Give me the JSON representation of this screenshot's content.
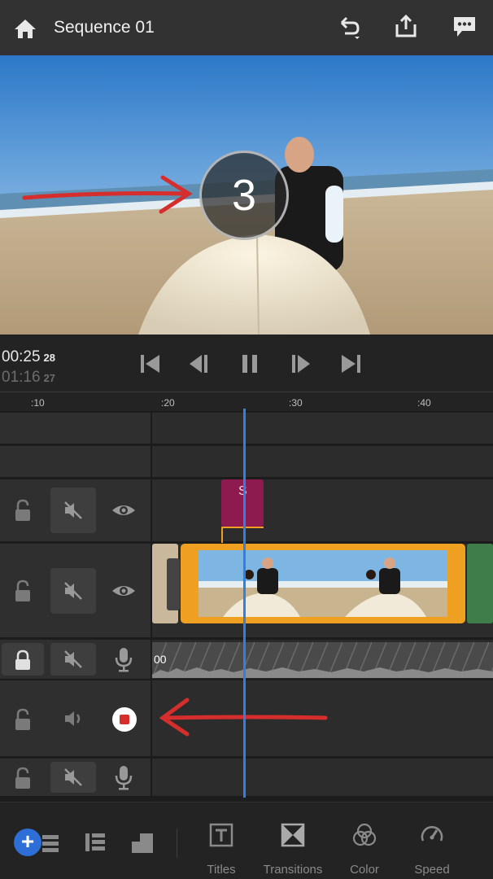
{
  "header": {
    "title": "Sequence 01"
  },
  "preview": {
    "countdown": "3"
  },
  "transport": {
    "current_time": "00:25",
    "current_frames": "28",
    "duration": "01:16",
    "duration_frames": "27"
  },
  "ruler": {
    "ticks": [
      ":10",
      ":20",
      ":30",
      ":40"
    ]
  },
  "timeline": {
    "title_clip_label": "S",
    "audio_clip_label": "00"
  },
  "toolbar": {
    "tools": [
      "Titles",
      "Transitions",
      "Color",
      "Speed"
    ],
    "add_label": "+"
  },
  "colors": {
    "accent_blue": "#2f7fe6",
    "clip_orange": "#f0a020",
    "title_clip": "#8e1b50",
    "annotation_red": "#d62d2d"
  }
}
